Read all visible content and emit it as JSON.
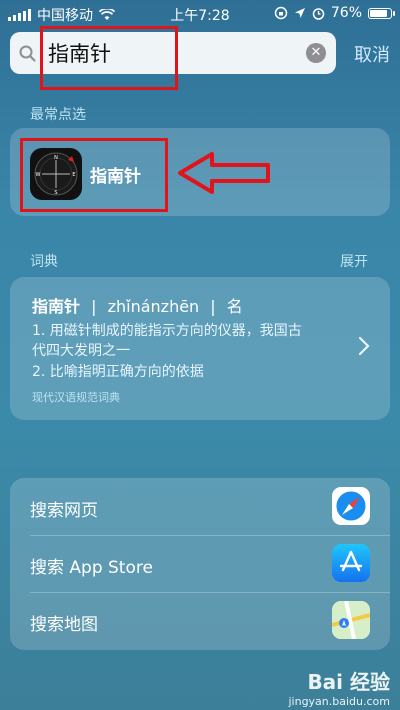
{
  "status": {
    "carrier": "中国移动",
    "time": "上午7:28",
    "battery": "76%",
    "battery_level": 0.76
  },
  "search": {
    "query": "指南针",
    "cancel_label": "取消"
  },
  "top_hits": {
    "section_label": "最常点选",
    "app_name": "指南针",
    "compass_letters": [
      "N",
      "E",
      "S",
      "W"
    ]
  },
  "dictionary": {
    "section_label": "词典",
    "expand_label": "展开",
    "headword": "指南针",
    "sep1": "|",
    "pinyin": "zhǐnánzhēn",
    "sep2": "|",
    "pos": "名",
    "def1_line1": "1. 用磁针制成的能指示方向的仪器，我国古",
    "def1_line2": "代四大发明之一",
    "def2": "2. 比喻指明正确方向的依据",
    "source": "现代汉语规范词典"
  },
  "actions": [
    {
      "label": "搜索网页",
      "icon": "safari-icon"
    },
    {
      "label": "搜索 App Store",
      "icon": "app-store-icon"
    },
    {
      "label": "搜索地图",
      "icon": "maps-icon"
    }
  ],
  "watermark": {
    "brand": "Bai  经验",
    "url": "jingyan.baidu.com"
  },
  "colors": {
    "annotation_red": "#e0141b",
    "cancel_blue": "#cfe9ff"
  }
}
